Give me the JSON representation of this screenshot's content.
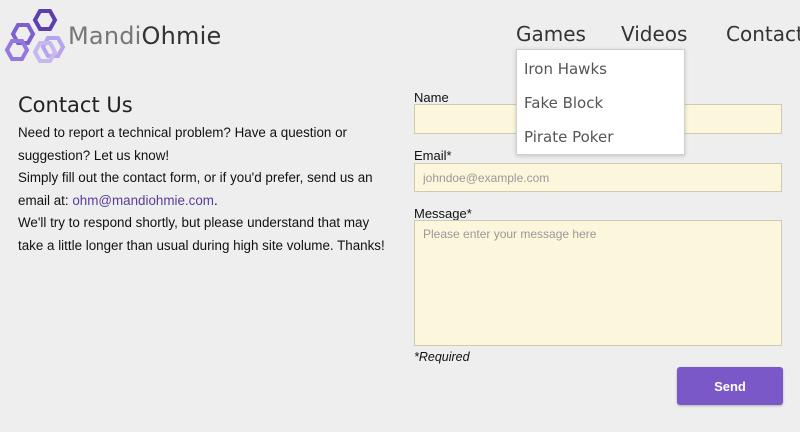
{
  "brand": {
    "name_part1": "Mandi",
    "name_part2": "Ohmie"
  },
  "nav": {
    "items": [
      {
        "label": "Games"
      },
      {
        "label": "Videos"
      },
      {
        "label": "Contact"
      }
    ],
    "dropdown": {
      "items": [
        {
          "label": "Iron Hawks"
        },
        {
          "label": "Fake Block"
        },
        {
          "label": "Pirate Poker"
        }
      ]
    }
  },
  "contact": {
    "title": "Contact Us",
    "line1": "Need to report a technical problem? Have a question or suggestion? Let us know!",
    "line2_prefix": "Simply fill out the contact form, or if you'd prefer, send us an email at: ",
    "email": "ohm@mandiohmie.com",
    "line2_suffix": ".",
    "line3": "We'll try to respond shortly, but please understand that may take a little longer than usual during high site volume. Thanks!"
  },
  "form": {
    "name_label": "Name",
    "name_value": "",
    "email_label": "Email*",
    "email_placeholder": "johndoe@example.com",
    "message_label": "Message*",
    "message_placeholder": "Please enter your message here",
    "required_note": "*Required",
    "send_label": "Send"
  },
  "colors": {
    "accent": "#7a58c7",
    "logo_hex": "#8a6cd4",
    "field_bg": "#fbf6dc",
    "page_bg": "#eeeeee",
    "link": "#5a3d9a"
  },
  "icons": {
    "logo": "hexagon-cluster-logo-icon"
  }
}
